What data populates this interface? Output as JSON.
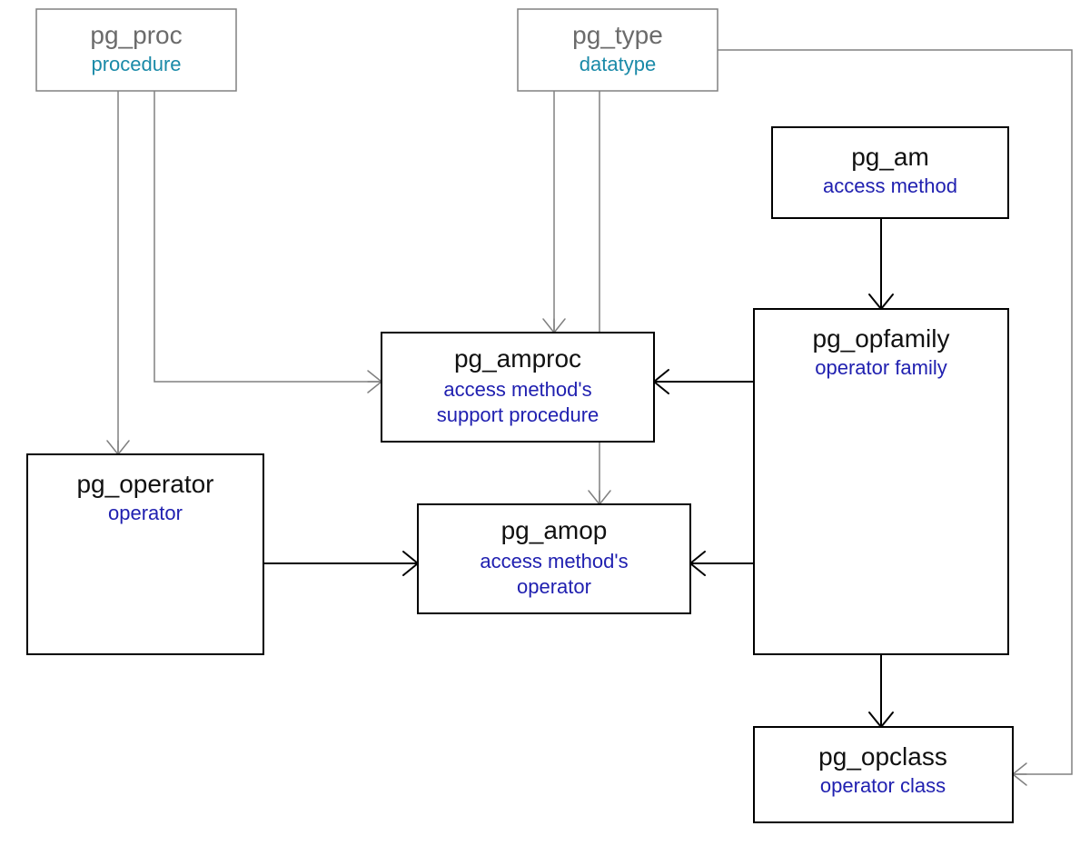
{
  "entities": {
    "pg_proc": {
      "title": "pg_proc",
      "subtitle": "procedure"
    },
    "pg_type": {
      "title": "pg_type",
      "subtitle": "datatype"
    },
    "pg_am": {
      "title": "pg_am",
      "subtitle": "access method"
    },
    "pg_amproc": {
      "title": "pg_amproc",
      "subtitle": "access method's support procedure"
    },
    "pg_operator": {
      "title": "pg_operator",
      "subtitle": "operator"
    },
    "pg_amop": {
      "title": "pg_amop",
      "subtitle": "access method's operator"
    },
    "pg_opfamily": {
      "title": "pg_opfamily",
      "subtitle": "operator family"
    },
    "pg_opclass": {
      "title": "pg_opclass",
      "subtitle": "operator class"
    }
  }
}
